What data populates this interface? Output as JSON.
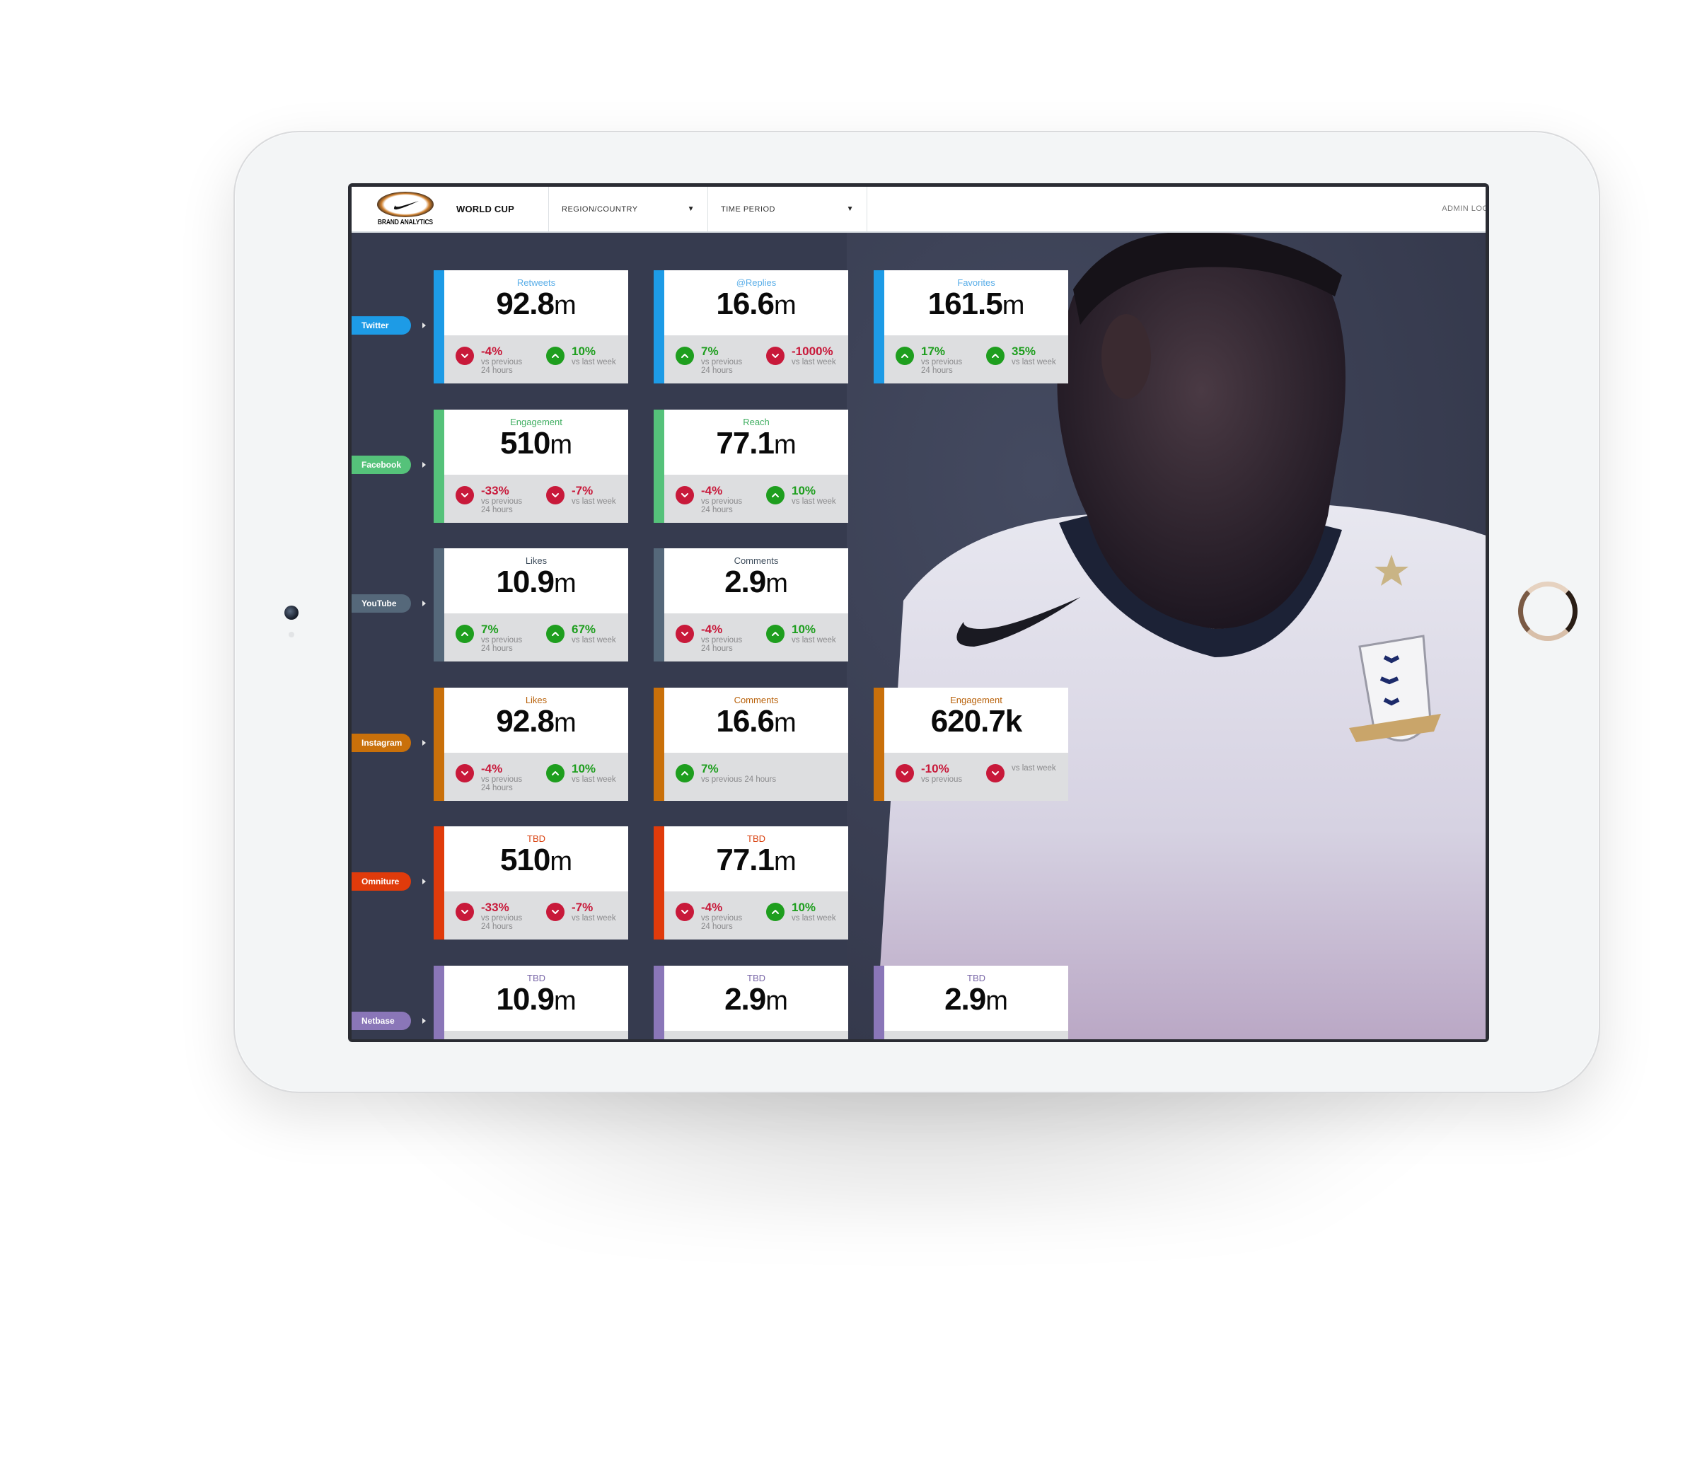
{
  "header": {
    "logo_text": "BRAND ANALYTICS",
    "title": "WORLD CUP",
    "region_dropdown": "REGION/COUNTRY",
    "time_dropdown": "TIME PERIOD",
    "admin_login": "ADMIN LOGI"
  },
  "colors": {
    "twitter": "#1d9be6",
    "facebook": "#55c27a",
    "youtube": "#55687a",
    "instagram": "#c9700a",
    "omniture": "#e03b0b",
    "netbase": "#8a76b8",
    "up": "#1e9e1e",
    "down": "#c8193a",
    "background": "#363b4f"
  },
  "rows": [
    {
      "source": "Twitter",
      "label_color": "#5aaee8",
      "cards": [
        {
          "label": "Retweets",
          "value": "92.8",
          "unit": "m",
          "stats": [
            {
              "dir": "down",
              "pct": "-4%",
              "caption": "vs previous",
              "caption2": "24 hours"
            },
            {
              "dir": "up",
              "pct": "10%",
              "caption": "vs last week",
              "caption2": ""
            }
          ]
        },
        {
          "label": "@Replies",
          "value": "16.6",
          "unit": "m",
          "stats": [
            {
              "dir": "up",
              "pct": "7%",
              "caption": "vs previous",
              "caption2": "24 hours"
            },
            {
              "dir": "down",
              "pct": "-1000%",
              "caption": "vs last week",
              "caption2": ""
            }
          ]
        },
        {
          "label": "Favorites",
          "value": "161.5",
          "unit": "m",
          "stats": [
            {
              "dir": "up",
              "pct": "17%",
              "caption": "vs previous",
              "caption2": "24 hours"
            },
            {
              "dir": "up",
              "pct": "35%",
              "caption": "vs last week",
              "caption2": ""
            }
          ]
        }
      ]
    },
    {
      "source": "Facebook",
      "label_color": "#3fae60",
      "cards": [
        {
          "label": "Engagement",
          "value": "510",
          "unit": "m",
          "stats": [
            {
              "dir": "down",
              "pct": "-33%",
              "caption": "vs previous",
              "caption2": "24 hours"
            },
            {
              "dir": "down",
              "pct": "-7%",
              "caption": "vs last week",
              "caption2": ""
            }
          ]
        },
        {
          "label": "Reach",
          "value": "77.1",
          "unit": "m",
          "stats": [
            {
              "dir": "down",
              "pct": "-4%",
              "caption": "vs previous",
              "caption2": "24 hours"
            },
            {
              "dir": "up",
              "pct": "10%",
              "caption": "vs last week",
              "caption2": ""
            }
          ]
        }
      ]
    },
    {
      "source": "YouTube",
      "label_color": "#3e4d5c",
      "cards": [
        {
          "label": "Likes",
          "value": "10.9",
          "unit": "m",
          "stats": [
            {
              "dir": "up",
              "pct": "7%",
              "caption": "vs previous",
              "caption2": "24 hours"
            },
            {
              "dir": "up",
              "pct": "67%",
              "caption": "vs last week",
              "caption2": ""
            }
          ]
        },
        {
          "label": "Comments",
          "value": "2.9",
          "unit": "m",
          "stats": [
            {
              "dir": "down",
              "pct": "-4%",
              "caption": "vs previous",
              "caption2": "24 hours"
            },
            {
              "dir": "up",
              "pct": "10%",
              "caption": "vs last week",
              "caption2": ""
            }
          ]
        }
      ]
    },
    {
      "source": "Instagram",
      "label_color": "#b8610a",
      "cards": [
        {
          "label": "Likes",
          "value": "92.8",
          "unit": "m",
          "stats": [
            {
              "dir": "down",
              "pct": "-4%",
              "caption": "vs previous",
              "caption2": "24 hours"
            },
            {
              "dir": "up",
              "pct": "10%",
              "caption": "vs last week",
              "caption2": ""
            }
          ]
        },
        {
          "label": "Comments",
          "value": "16.6",
          "unit": "m",
          "stats": [
            {
              "dir": "up",
              "pct": "7%",
              "caption": "vs previous 24 hours",
              "caption2": "",
              "wide": true
            }
          ]
        },
        {
          "label": "Engagement",
          "value": "620.7k",
          "unit": "",
          "stats": [
            {
              "dir": "down",
              "pct": "-10%",
              "caption": "vs previous",
              "caption2": ""
            },
            {
              "dir": "down",
              "pct": "",
              "caption": "vs last week",
              "caption2": ""
            }
          ]
        }
      ]
    },
    {
      "source": "Omniture",
      "label_color": "#d8400e",
      "cards": [
        {
          "label": "TBD",
          "value": "510",
          "unit": "m",
          "stats": [
            {
              "dir": "down",
              "pct": "-33%",
              "caption": "vs previous",
              "caption2": "24 hours"
            },
            {
              "dir": "down",
              "pct": "-7%",
              "caption": "vs last week",
              "caption2": ""
            }
          ]
        },
        {
          "label": "TBD",
          "value": "77.1",
          "unit": "m",
          "stats": [
            {
              "dir": "down",
              "pct": "-4%",
              "caption": "vs previous",
              "caption2": "24 hours"
            },
            {
              "dir": "up",
              "pct": "10%",
              "caption": "vs last week",
              "caption2": ""
            }
          ]
        }
      ]
    },
    {
      "source": "Netbase",
      "label_color": "#7a68a8",
      "cards": [
        {
          "label": "TBD",
          "value": "10.9",
          "unit": "m",
          "stats": []
        },
        {
          "label": "TBD",
          "value": "2.9",
          "unit": "m",
          "stats": []
        },
        {
          "label": "TBD",
          "value": "2.9",
          "unit": "m",
          "stats": []
        }
      ]
    }
  ]
}
